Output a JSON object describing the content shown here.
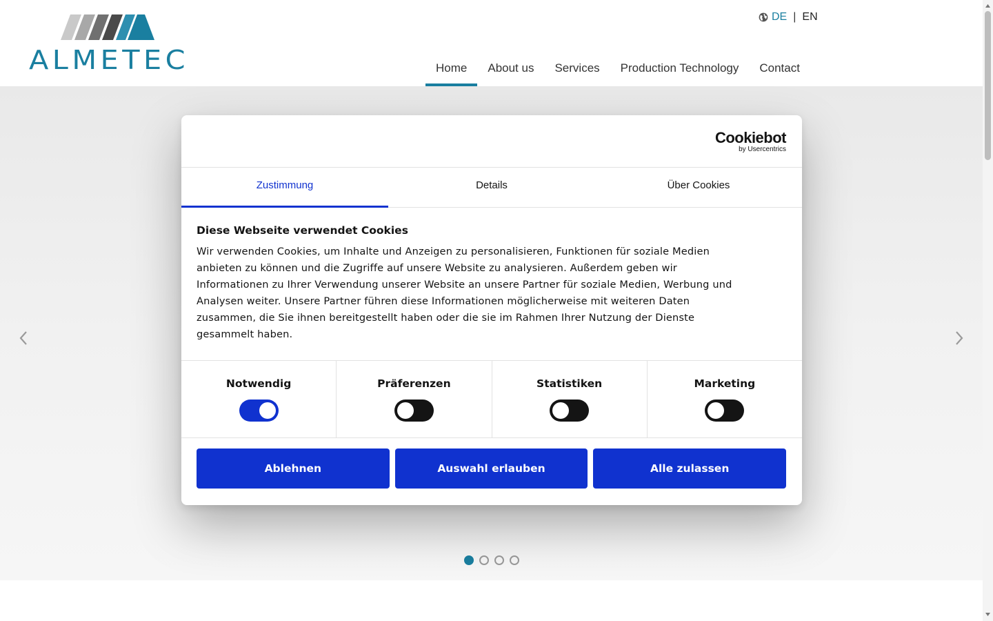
{
  "header": {
    "logo_text": "ALMETEC",
    "language": {
      "active": "DE",
      "other": "EN",
      "separator": "|"
    },
    "nav": [
      {
        "label": "Home",
        "active": true
      },
      {
        "label": "About us",
        "active": false
      },
      {
        "label": "Services",
        "active": false
      },
      {
        "label": "Production Technology",
        "active": false
      },
      {
        "label": "Contact",
        "active": false
      }
    ]
  },
  "slider": {
    "slide_count": 4,
    "active_slide": 1
  },
  "cookie_dialog": {
    "brand_name": "Cookiebot",
    "brand_sub": "by Usercentrics",
    "tabs": [
      {
        "label": "Zustimmung",
        "active": true
      },
      {
        "label": "Details",
        "active": false
      },
      {
        "label": "Über Cookies",
        "active": false
      }
    ],
    "title": "Diese Webseite verwendet Cookies",
    "text_lines": [
      "Wir verwenden Cookies, um Inhalte und Anzeigen zu personalisieren, Funktionen für soziale Medien",
      "anbieten zu können und die Zugriffe auf unsere Website zu analysieren. Außerdem geben wir",
      "Informationen zu Ihrer Verwendung unserer Website an unsere Partner für soziale Medien, Werbung und",
      "Analysen weiter. Unsere Partner führen diese Informationen möglicherweise mit weiteren Daten",
      "zusammen, die Sie ihnen bereitgestellt haben oder die sie im Rahmen Ihrer Nutzung der Dienste",
      "gesammelt haben."
    ],
    "categories": [
      {
        "label": "Notwendig",
        "enabled": true
      },
      {
        "label": "Präferenzen",
        "enabled": false
      },
      {
        "label": "Statistiken",
        "enabled": false
      },
      {
        "label": "Marketing",
        "enabled": false
      }
    ],
    "buttons": {
      "decline": "Ablehnen",
      "allow_selection": "Auswahl erlauben",
      "allow_all": "Alle zulassen"
    }
  },
  "colors": {
    "brand_teal": "#1a7fa0",
    "cookiebot_blue": "#1032cf",
    "text_dark": "#141414"
  },
  "icons": {
    "language": "globe-icon",
    "slider_prev": "chevron-left-icon",
    "slider_next": "chevron-right-icon"
  }
}
